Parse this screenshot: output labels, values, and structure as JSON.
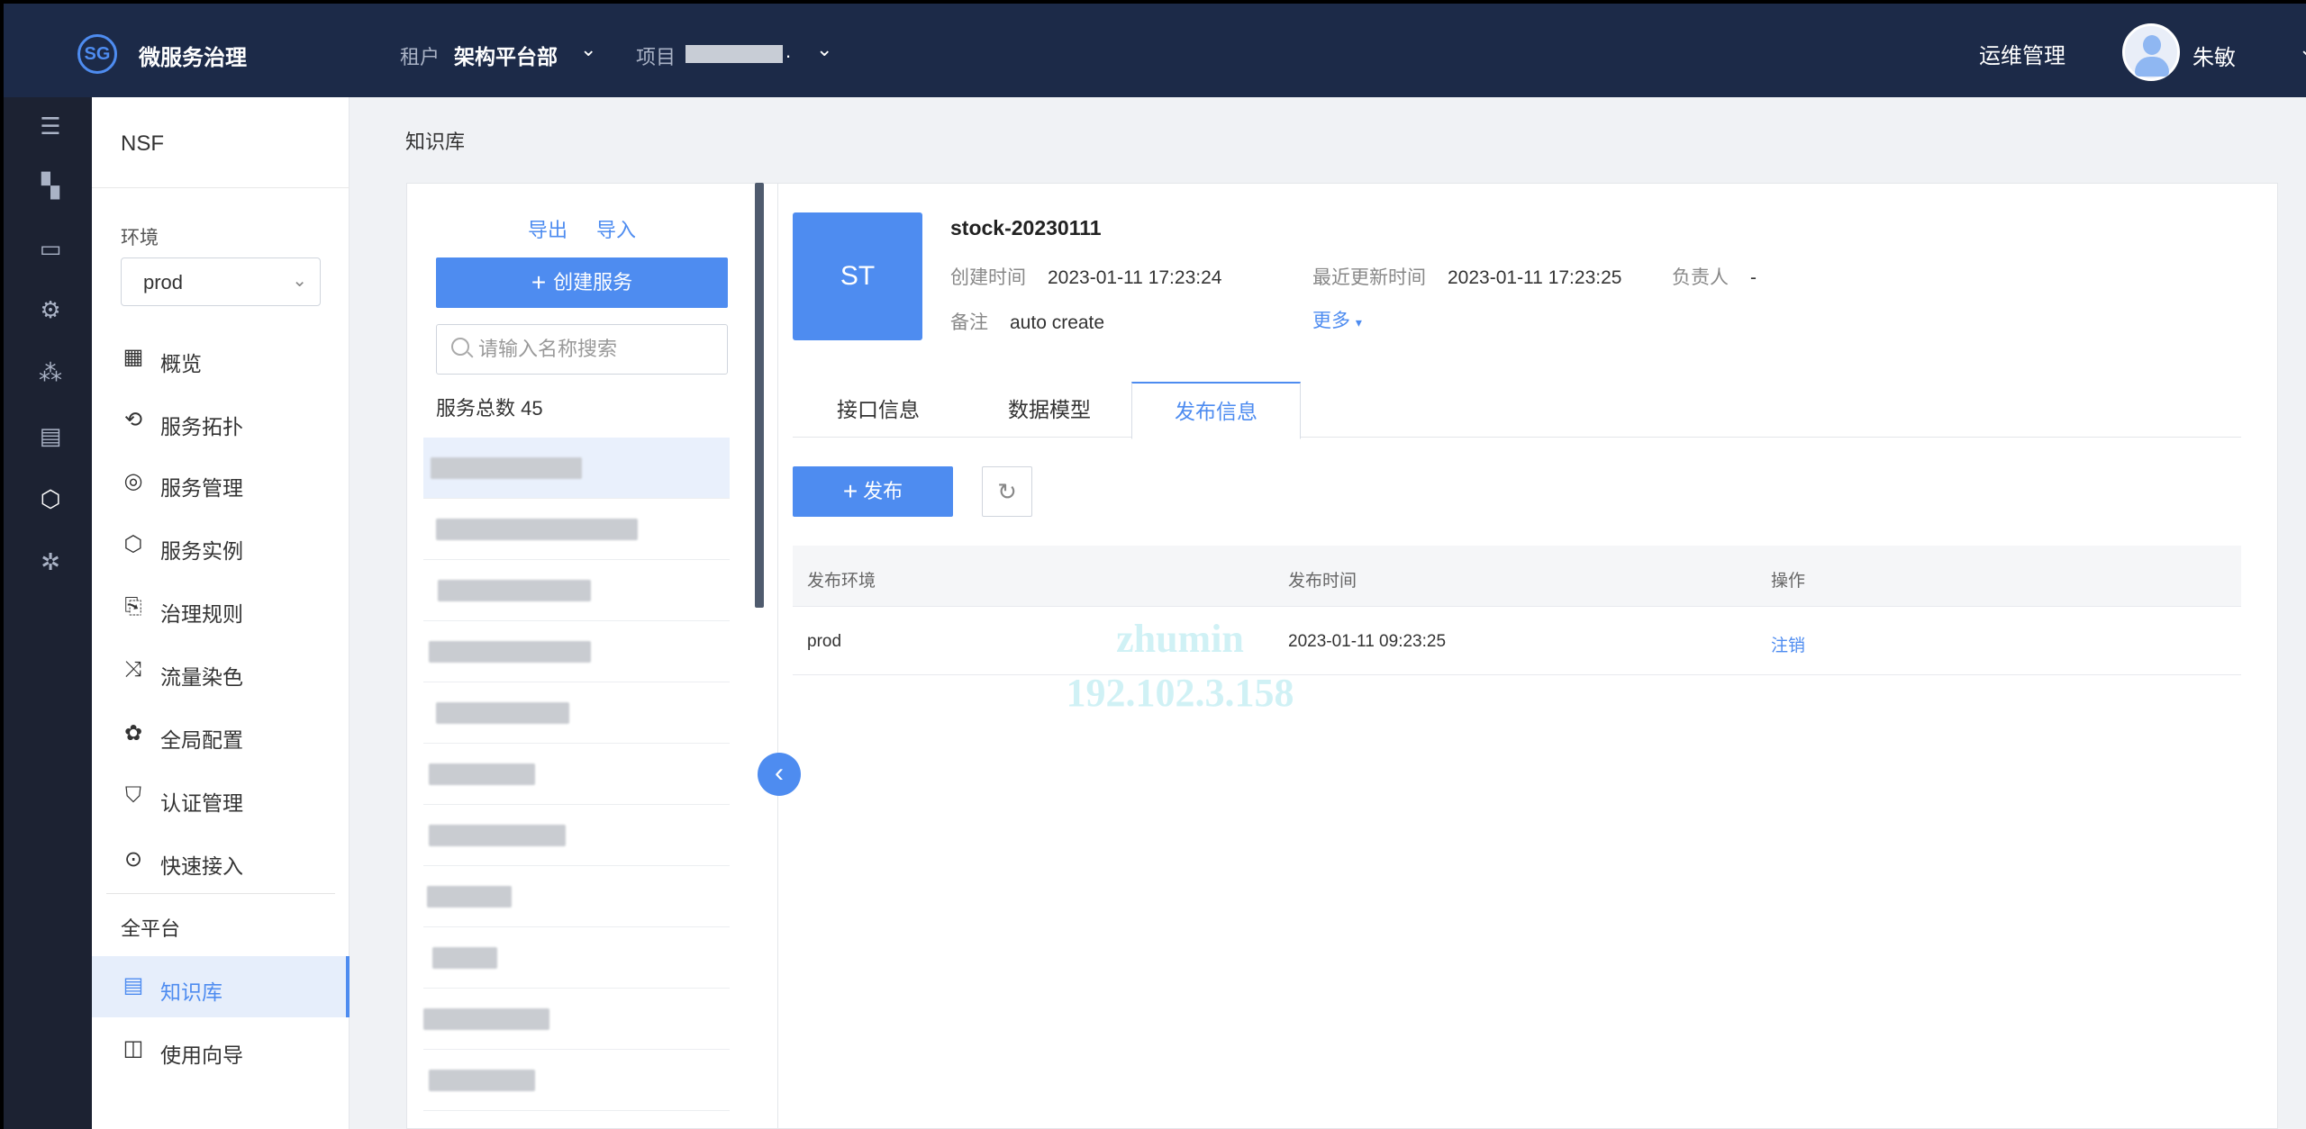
{
  "header": {
    "logo_text": "SG",
    "app_title": "微服务治理",
    "tenant_label": "租户",
    "tenant_value": "架构平台部",
    "project_label": "项目",
    "project_suffix": ".",
    "ops_label": "运维管理",
    "user_name": "朱敏"
  },
  "rail": {
    "icons": [
      "menu-icon",
      "dashboard-icon",
      "monitor-icon",
      "settings-screen-icon",
      "cluster-icon",
      "document-icon",
      "cube-icon",
      "bug-icon"
    ]
  },
  "sidebar": {
    "app_name": "NSF",
    "env_label": "环境",
    "env_value": "prod",
    "items": [
      {
        "label": "概览",
        "icon": "overview-icon"
      },
      {
        "label": "服务拓扑",
        "icon": "topology-icon"
      },
      {
        "label": "服务管理",
        "icon": "service-manage-icon"
      },
      {
        "label": "服务实例",
        "icon": "instance-icon"
      },
      {
        "label": "治理规则",
        "icon": "rule-icon"
      },
      {
        "label": "流量染色",
        "icon": "traffic-icon"
      },
      {
        "label": "全局配置",
        "icon": "global-config-icon"
      },
      {
        "label": "认证管理",
        "icon": "shield-icon"
      },
      {
        "label": "快速接入",
        "icon": "quick-access-icon"
      }
    ],
    "section_title": "全平台",
    "platform_items": [
      {
        "label": "知识库",
        "icon": "knowledge-base-icon",
        "active": true
      },
      {
        "label": "使用向导",
        "icon": "guide-icon"
      }
    ]
  },
  "breadcrumb": "知识库",
  "service_list": {
    "export_label": "导出",
    "import_label": "导入",
    "create_label": "创建服务",
    "search_placeholder": "请输入名称搜索",
    "count_label": "服务总数 45"
  },
  "detail": {
    "badge": "ST",
    "name": "stock-20230111",
    "created_key": "创建时间",
    "created_value": "2023-01-11 17:23:24",
    "updated_key": "最近更新时间",
    "updated_value": "2023-01-11 17:23:25",
    "owner_key": "负责人",
    "owner_value": "-",
    "note_key": "备注",
    "note_value": "auto create",
    "more_label": "更多",
    "tabs": [
      "接口信息",
      "数据模型",
      "发布信息"
    ],
    "active_tab": "发布信息",
    "publish_label": "发布",
    "table": {
      "headers": [
        "发布环境",
        "发布时间",
        "操作"
      ],
      "rows": [
        {
          "env": "prod",
          "time": "2023-01-11 09:23:25",
          "action": "注销"
        }
      ]
    },
    "watermark_line1": "zhumin",
    "watermark_line2": "192.102.3.158"
  },
  "colors": {
    "header_bg": "#1c2a48",
    "rail_bg": "#1c2232",
    "accent": "#4e8cf0"
  }
}
